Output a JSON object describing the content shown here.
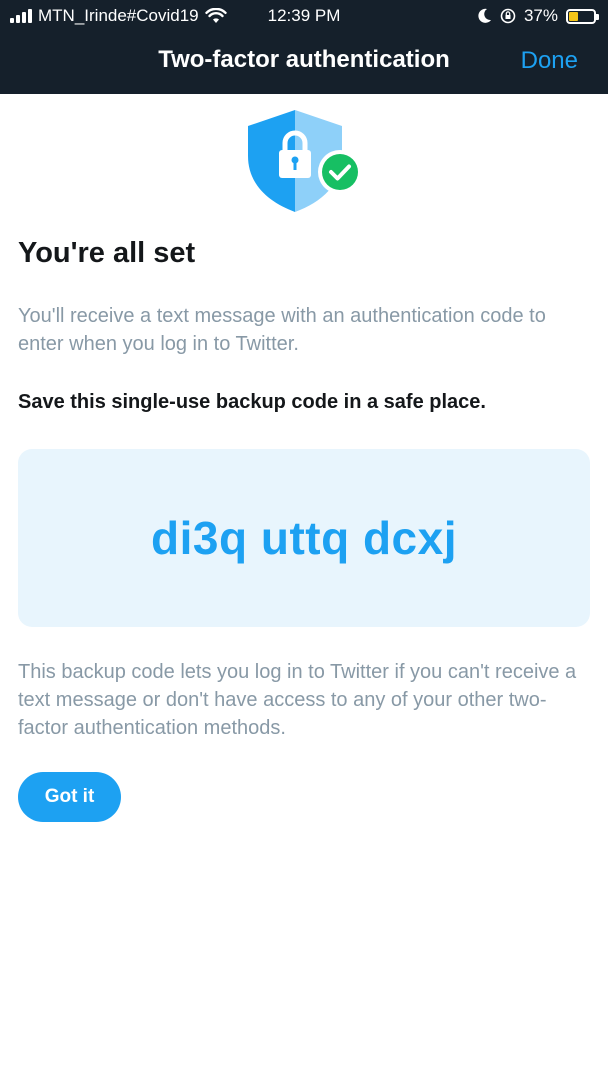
{
  "status_bar": {
    "carrier": "MTN_Irinde#Covid19",
    "time": "12:39 PM",
    "battery": "37%",
    "battery_level": 0.37
  },
  "nav": {
    "title": "Two-factor authentication",
    "done_label": "Done"
  },
  "content": {
    "heading": "You're all set",
    "description": "You'll receive a text message with an authentication code to enter when you log in to Twitter.",
    "save_instruction": "Save this single-use backup code in a safe place.",
    "backup_code": "di3q uttq dcxj",
    "backup_description": "This backup code lets you log in to Twitter if you can't receive a text message or don't have access to any of your other two-factor authentication methods.",
    "button_label": "Got it"
  },
  "colors": {
    "header_bg": "#15202b",
    "accent": "#1da1f2",
    "code_bg": "#e8f5fd",
    "secondary_text": "#8899a6",
    "check_green": "#17bf63"
  },
  "icons": [
    "signal-icon",
    "wifi-icon",
    "moon-icon",
    "orientation-lock-icon",
    "battery-icon",
    "shield-lock-icon",
    "check-icon"
  ]
}
